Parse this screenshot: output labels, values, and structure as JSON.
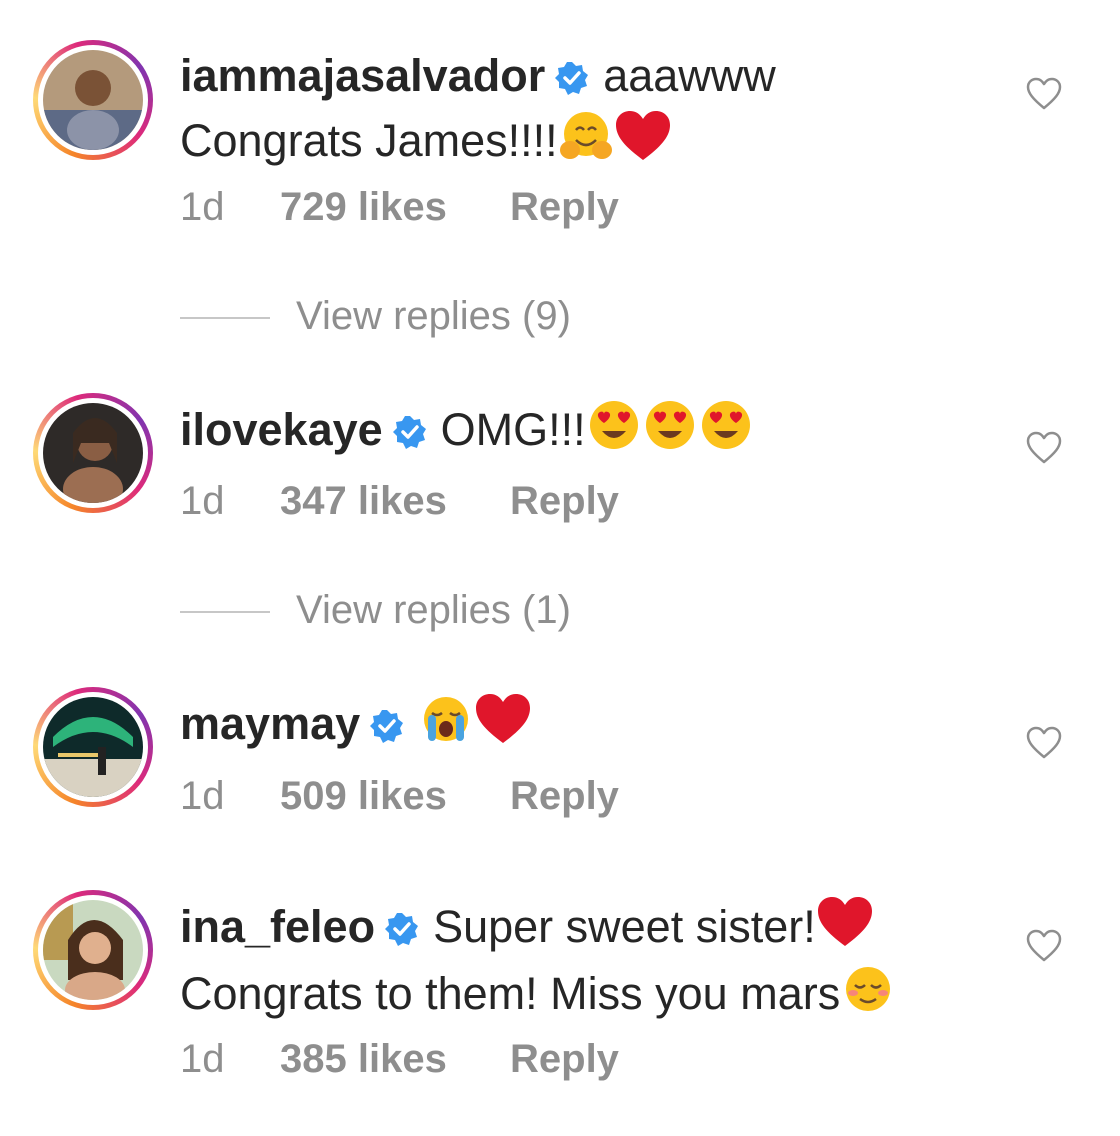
{
  "comments": [
    {
      "username": "iammajasalvador",
      "text_line1": "aaawww",
      "text_line2": "Congrats James!!!!",
      "time": "1d",
      "likes": "729 likes",
      "reply": "Reply",
      "emojis": [
        "hugging-face-emoji",
        "red-heart-emoji"
      ]
    },
    {
      "username": "ilovekaye",
      "text_line1": "OMG!!!",
      "time": "1d",
      "likes": "347 likes",
      "reply": "Reply",
      "emojis": [
        "heart-eyes-emoji",
        "heart-eyes-emoji",
        "heart-eyes-emoji"
      ]
    },
    {
      "username": "maymay",
      "text_line1": "",
      "time": "1d",
      "likes": "509 likes",
      "reply": "Reply",
      "emojis": [
        "loudly-crying-face-emoji",
        "red-heart-emoji"
      ]
    },
    {
      "username": "ina_feleo",
      "text_line1": "Super sweet sister!",
      "text_line2": "Congrats to them! Miss you mars",
      "time": "1d",
      "likes": "385 likes",
      "reply": "Reply",
      "emojis": [
        "red-heart-emoji",
        "relieved-face-emoji"
      ]
    }
  ],
  "view_replies": [
    {
      "label": "View replies (9)"
    },
    {
      "label": "View replies (1)"
    }
  ],
  "colors": {
    "text": "#262626",
    "secondary": "#8e8e8e",
    "verified": "#3897f0",
    "heart_red": "#e0162b",
    "divider": "#c7c7c7"
  }
}
